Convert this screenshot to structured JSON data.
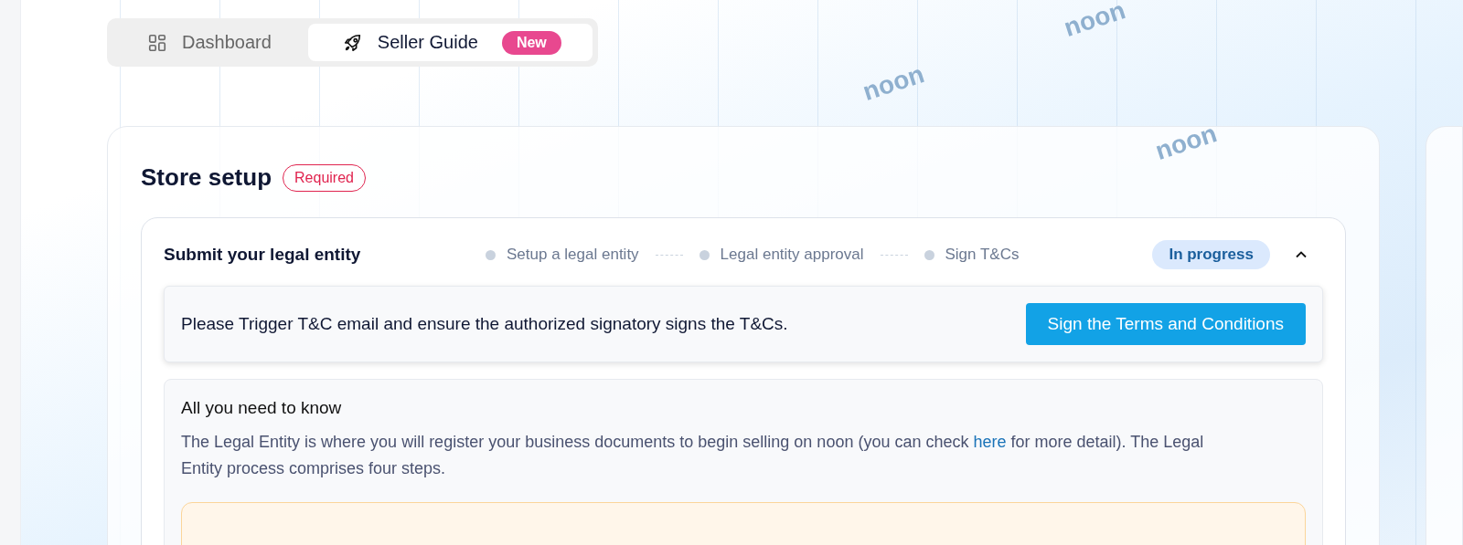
{
  "background_logos": [
    "noon",
    "noon",
    "noon"
  ],
  "nav_tabs": [
    {
      "label": "Dashboard",
      "selected": false
    },
    {
      "label": "Seller Guide",
      "selected": true,
      "badge": "New"
    }
  ],
  "section": {
    "title": "Store setup",
    "tag": "Required",
    "task": {
      "title": "Submit your legal entity",
      "expanded": true,
      "status": "In progress",
      "steps": [
        "Setup a legal entity",
        "Legal entity approval",
        "Sign T&Cs"
      ],
      "notice": {
        "text": "Please Trigger T&C email and ensure the authorized signatory signs the T&Cs.",
        "button": "Sign the Terms and Conditions"
      },
      "info": {
        "title": "All you need to know",
        "text_before": "The Legal Entity is where you will register your business documents to begin selling on noon (you can check",
        "link": "here",
        "text_after": "for more detail). The Legal Entity process comprises four steps."
      }
    }
  }
}
